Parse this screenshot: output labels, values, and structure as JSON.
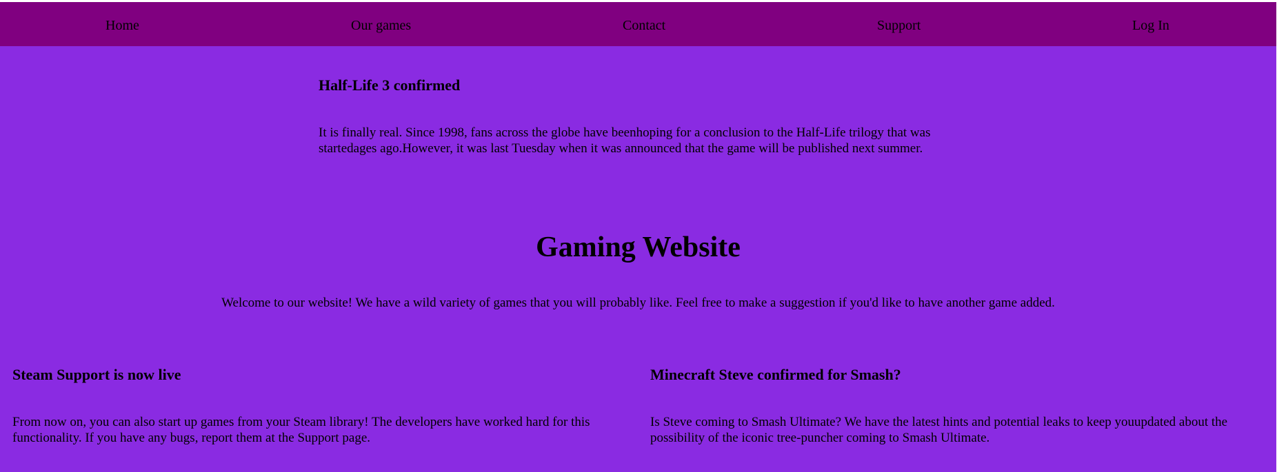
{
  "nav": {
    "home": "Home",
    "games": "Our games",
    "contact": "Contact",
    "support": "Support",
    "login": "Log In"
  },
  "featured": {
    "title": "Half-Life 3 confirmed",
    "body": "It is finally real. Since 1998, fans across the globe have beenhoping for a conclusion to the Half-Life trilogy that was startedages ago.However, it was last Tuesday when it was announced that the game will be published next summer."
  },
  "hero": {
    "title": "Gaming Website",
    "welcome": "Welcome to our website! We have a wild variety of games that you will probably like. Feel free to make a suggestion if you'd like to have another game added."
  },
  "news": [
    {
      "title": "Steam Support is now live",
      "body": "From now on, you can also start up games from your Steam library! The developers have worked hard for this functionality. If you have any bugs, report them at the Support page."
    },
    {
      "title": "Minecraft Steve confirmed for Smash?",
      "body": "Is Steve coming to Smash Ultimate? We have the latest hints and potential leaks to keep youupdated about the possibility of the iconic tree-puncher coming to Smash Ultimate."
    }
  ],
  "colors": {
    "page_background": "#8a2be2",
    "navbar_background": "#800080",
    "text": "#000000"
  }
}
